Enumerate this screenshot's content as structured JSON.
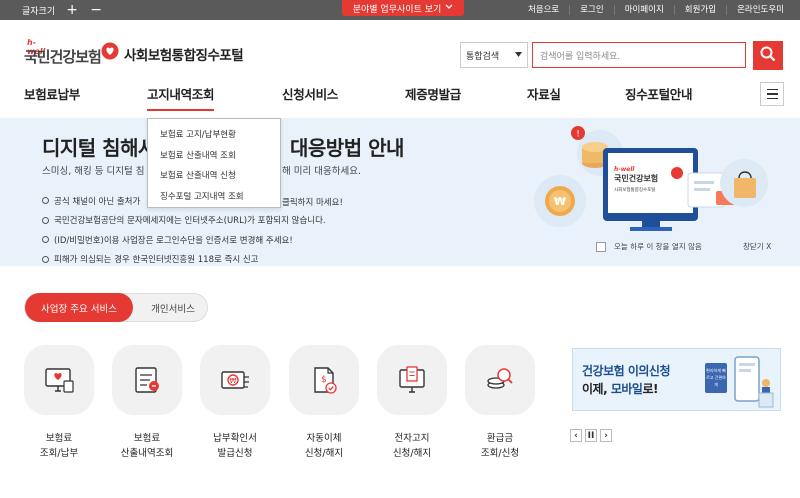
{
  "topbar": {
    "font_size_label": "글자크기",
    "font_plus": "+",
    "font_minus": "−",
    "quick_site_label": "분야별 업무사이트 보기",
    "links": [
      "처음으로",
      "로그인",
      "마이페이지",
      "회원가입",
      "온라인도우미"
    ]
  },
  "header": {
    "logo_hwell": "h-well",
    "logo_name": "국민건강보험",
    "portal_name": "사회보험통합징수포털",
    "search_select": "통합검색",
    "search_placeholder": "검색어를 입력하세요."
  },
  "gnb": {
    "items": [
      "보험료납부",
      "고지내역조회",
      "신청서비스",
      "제증명발급",
      "자료실",
      "징수포털안내"
    ]
  },
  "dropdown": {
    "items": [
      "보험료 고지/납부현황",
      "보험료 산출내역 조회",
      "보험료 산출내역 신청",
      "징수포털 고지내역 조회"
    ]
  },
  "banner": {
    "title_left": "디지털 침해사",
    "title_right": "대응방법 안내",
    "sub_left": "스미싱, 해킹 등 디지털 침",
    "sub_right": "해 미리 대응하세요.",
    "bullets": [
      {
        "text": "공식 채널이 아닌 출처가",
        "tail": "클릭하지 마세요!"
      },
      {
        "text": "국민건강보험공단의 문자메세지에는 인터넷주소(URL)가 포함되지 않습니다.",
        "tail": ""
      },
      {
        "text": "(ID/비밀번호)이용 사업장은 로그인수단을 인증서로 변경해 주세요!",
        "tail": ""
      },
      {
        "text": "피해가 의심되는 경우 한국인터넷진흥원 118로 즉시 신고",
        "tail": ""
      }
    ],
    "no_show_today": "오늘 하루 이 창을 열지 않음",
    "close_label": "창닫기 X",
    "illus_logo_hwell": "h-well",
    "illus_logo_name": "국민건강보험",
    "illus_logo_sub": "사회보험통합징수포털"
  },
  "service_tabs": {
    "active": "사업장 주요 서비스",
    "inactive": "개인서비스"
  },
  "services": [
    {
      "line1": "보험료",
      "line2": "조회/납부",
      "icon": "monitor-heart-icon"
    },
    {
      "line1": "보험료",
      "line2": "산출내역조회",
      "icon": "document-list-icon"
    },
    {
      "line1": "납부확인서",
      "line2": "발급신청",
      "icon": "card-won-icon"
    },
    {
      "line1": "자동이체",
      "line2": "신청/해지",
      "icon": "document-check-icon"
    },
    {
      "line1": "전자고지",
      "line2": "신청/해지",
      "icon": "monitor-document-icon"
    },
    {
      "line1": "환급금",
      "line2": "조회/신청",
      "icon": "coin-search-icon"
    }
  ],
  "promo": {
    "line1": "건강보험 이의신청",
    "line2_prefix": "이제,",
    "line2_emph": "모바일",
    "line2_suffix": "로!",
    "badge": "편리하게 빠르고 간편하게"
  },
  "pager": {
    "prev": "‹",
    "pause": "II",
    "next": "›"
  },
  "colors": {
    "accent": "#e43a33",
    "banner_bg": "#e9f2fb",
    "topbar": "#5a5a5a",
    "promo_blue": "#1b4e8f"
  }
}
